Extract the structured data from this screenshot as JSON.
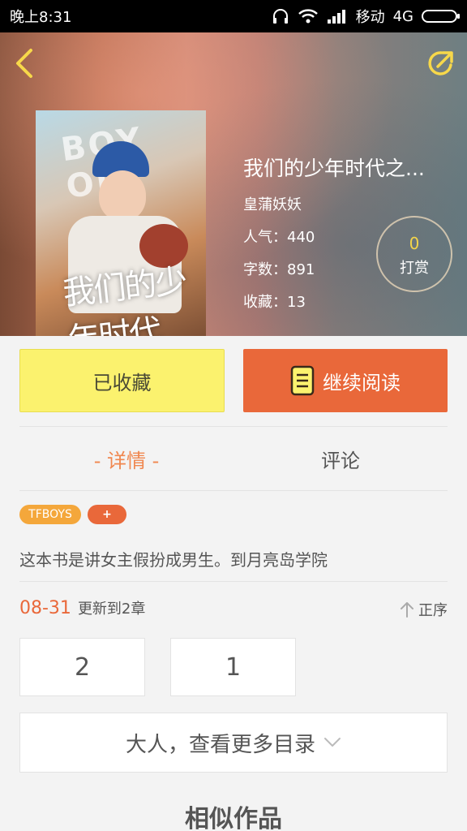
{
  "status_bar": {
    "time": "晚上8:31",
    "carrier": "移动",
    "network": "4G"
  },
  "book": {
    "cover_art_text_top": "BOY  OD",
    "cover_art_text": "我们的少年时代",
    "title": "我们的少年时代之...",
    "author": "皇蒲妖妖",
    "popularity": "人气：440",
    "word_count": "字数：891",
    "favorites": "收藏：13"
  },
  "tip": {
    "count": "0",
    "label": "打赏"
  },
  "actions": {
    "favorited_label": "已收藏",
    "continue_label": "继续阅读"
  },
  "tabs": {
    "detail": "- 详情 -",
    "comment": "评论"
  },
  "tags": {
    "items": [
      "TFBOYS"
    ],
    "add_label": "+"
  },
  "description": "这本书是讲女主假扮成男生。到月亮岛学院",
  "update": {
    "date": "08-31",
    "text": "更新到2章",
    "order_label": "正序"
  },
  "chapters": [
    "2",
    "1"
  ],
  "more_catalog_label": "大人，查看更多目录",
  "similar_title": "相似作品",
  "colors": {
    "accent_orange": "#e9683a",
    "tab_active": "#f0874f",
    "fav_yellow": "#fbf26e",
    "tag_orange": "#f4a73b",
    "icon_yellow": "#f7d84a"
  }
}
